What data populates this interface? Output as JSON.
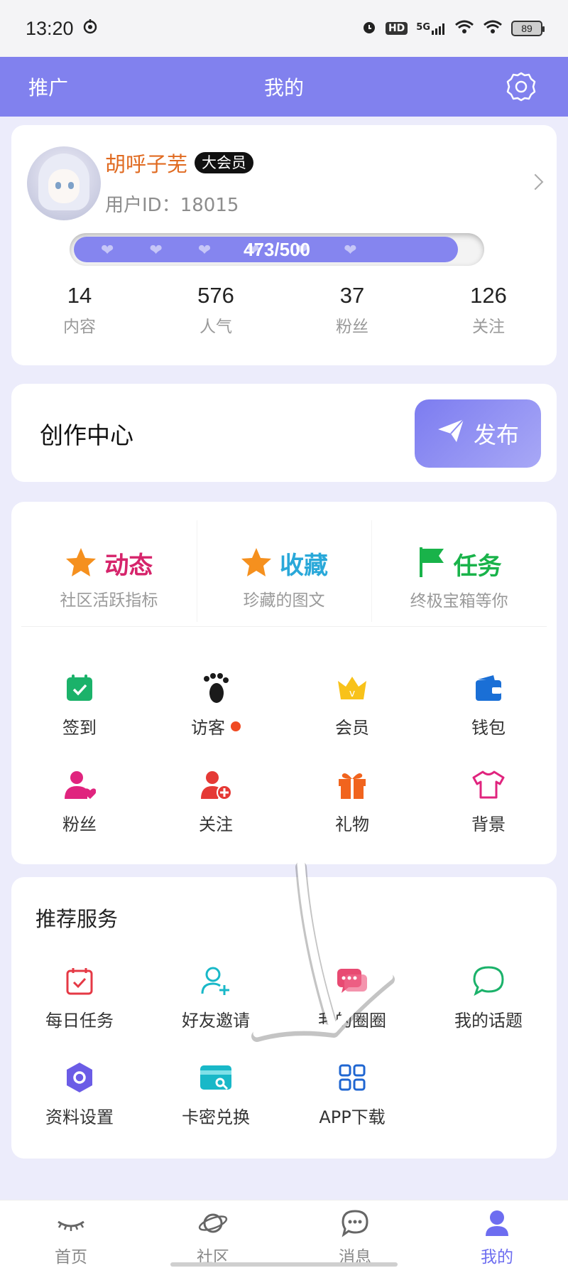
{
  "status_bar": {
    "time": "13:20",
    "hd": "HD",
    "network": "5G",
    "battery": "89"
  },
  "header": {
    "left": "推广",
    "title": "我的",
    "settings_icon": "gear-icon"
  },
  "profile": {
    "username": "胡呼子芜",
    "vip_badge": "大会员",
    "user_id": "用户ID：18015",
    "progress_text": "473/500",
    "progress_fraction": 0.946,
    "stats": [
      {
        "value": "14",
        "label": "内容"
      },
      {
        "value": "576",
        "label": "人气"
      },
      {
        "value": "37",
        "label": "粉丝"
      },
      {
        "value": "126",
        "label": "关注"
      }
    ]
  },
  "creation": {
    "title": "创作中心",
    "publish_label": "发布"
  },
  "features": {
    "big": [
      {
        "title": "动态",
        "sub": "社区活跃指标",
        "color": "#d6246b",
        "icon": "star-icon"
      },
      {
        "title": "收藏",
        "sub": "珍藏的图文",
        "color": "#29a8d9",
        "icon": "star-icon"
      },
      {
        "title": "任务",
        "sub": "终极宝箱等你",
        "color": "#19b34a",
        "icon": "flag-icon"
      }
    ],
    "grid": [
      {
        "label": "签到",
        "icon": "calendar-check-icon"
      },
      {
        "label": "访客",
        "icon": "footprint-icon"
      },
      {
        "label": "会员",
        "icon": "crown-icon"
      },
      {
        "label": "钱包",
        "icon": "wallet-icon"
      },
      {
        "label": "粉丝",
        "icon": "fan-heart-icon"
      },
      {
        "label": "关注",
        "icon": "follow-plus-icon"
      },
      {
        "label": "礼物",
        "icon": "gift-icon"
      },
      {
        "label": "背景",
        "icon": "shirt-icon"
      }
    ]
  },
  "services": {
    "title": "推荐服务",
    "items": [
      {
        "label": "每日任务",
        "icon": "daily-task-icon"
      },
      {
        "label": "好友邀请",
        "icon": "invite-friend-icon"
      },
      {
        "label": "我的圈圈",
        "icon": "chat-bubbles-icon"
      },
      {
        "label": "我的话题",
        "icon": "topic-bubble-icon"
      },
      {
        "label": "资料设置",
        "icon": "settings-hex-icon"
      },
      {
        "label": "卡密兑换",
        "icon": "card-redeem-icon"
      },
      {
        "label": "APP下载",
        "icon": "app-grid-icon"
      }
    ]
  },
  "nav": [
    {
      "label": "首页",
      "icon": "eye-lash-icon"
    },
    {
      "label": "社区",
      "icon": "planet-icon"
    },
    {
      "label": "消息",
      "icon": "message-icon"
    },
    {
      "label": "我的",
      "icon": "user-icon"
    }
  ]
}
